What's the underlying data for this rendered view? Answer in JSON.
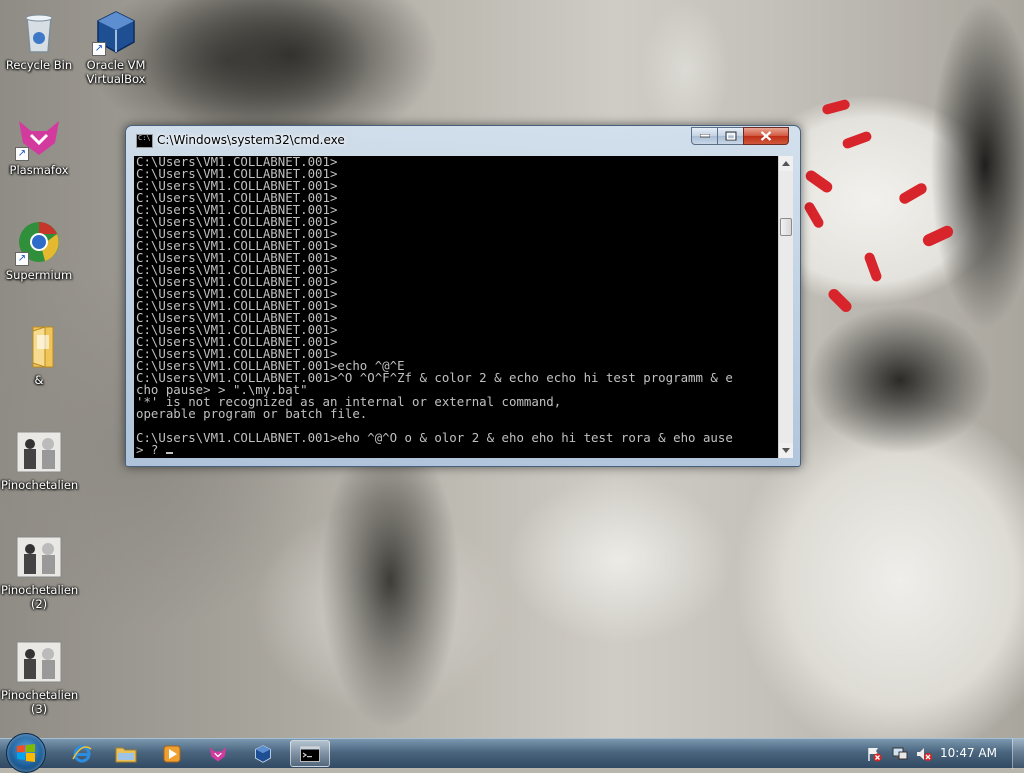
{
  "desktop": {
    "icons": [
      {
        "label": "Recycle Bin",
        "icon": "recycle-bin-icon"
      },
      {
        "label": "Oracle VM VirtualBox",
        "icon": "virtualbox-icon"
      },
      {
        "label": "Plasmafox",
        "icon": "plasmafox-icon"
      },
      {
        "label": "Supermium",
        "icon": "supermium-icon"
      },
      {
        "label": "&",
        "icon": "folder-icon"
      },
      {
        "label": "Pinochetalien",
        "icon": "image-thumbnail-icon"
      },
      {
        "label": "Pinochetalien (2)",
        "icon": "image-thumbnail-icon"
      },
      {
        "label": "Pinochetalien (3)",
        "icon": "image-thumbnail-icon"
      }
    ]
  },
  "cmd_window": {
    "title": "C:\\Windows\\system32\\cmd.exe",
    "console_text": "C:\\Users\\VM1.COLLABNET.001>\nC:\\Users\\VM1.COLLABNET.001>\nC:\\Users\\VM1.COLLABNET.001>\nC:\\Users\\VM1.COLLABNET.001>\nC:\\Users\\VM1.COLLABNET.001>\nC:\\Users\\VM1.COLLABNET.001>\nC:\\Users\\VM1.COLLABNET.001>\nC:\\Users\\VM1.COLLABNET.001>\nC:\\Users\\VM1.COLLABNET.001>\nC:\\Users\\VM1.COLLABNET.001>\nC:\\Users\\VM1.COLLABNET.001>\nC:\\Users\\VM1.COLLABNET.001>\nC:\\Users\\VM1.COLLABNET.001>\nC:\\Users\\VM1.COLLABNET.001>\nC:\\Users\\VM1.COLLABNET.001>\nC:\\Users\\VM1.COLLABNET.001>\nC:\\Users\\VM1.COLLABNET.001>\nC:\\Users\\VM1.COLLABNET.001>echo ^@^E\nC:\\Users\\VM1.COLLABNET.001>^O ^O^F^Zf & color 2 & echo echo hi test programm & e\ncho pause> > \".\\my.bat\"\n'*' is not recognized as an internal or external command,\noperable program or batch file.\n\nC:\\Users\\VM1.COLLABNET.001>eho ^@^O o & olor 2 & eho eho hi test rora & eho ause\n> ? ",
    "buttons": {
      "minimize": "minimize",
      "maximize": "maximize",
      "close": "close"
    }
  },
  "taskbar": {
    "pinned": [
      {
        "name": "internet-explorer-icon"
      },
      {
        "name": "windows-explorer-icon"
      },
      {
        "name": "media-player-icon"
      },
      {
        "name": "plasmafox-icon"
      },
      {
        "name": "virtualbox-icon"
      },
      {
        "name": "cmd-icon",
        "active": true
      }
    ],
    "clock": "10:47 AM"
  },
  "colors": {
    "console_bg": "#000000",
    "console_fg": "#c0c0c0",
    "wallpaper_marks": "#d8242b"
  }
}
